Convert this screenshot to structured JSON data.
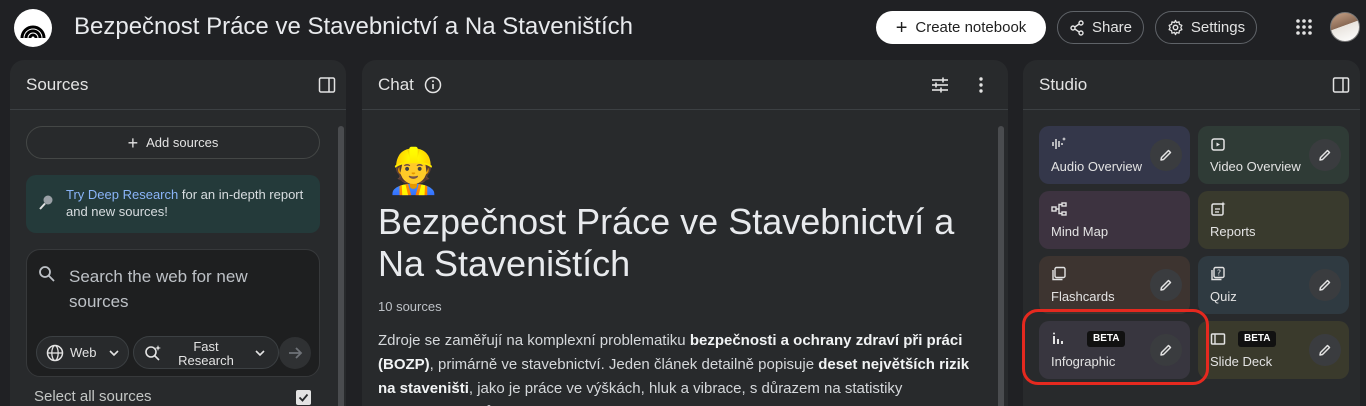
{
  "app": {
    "title": "Bezpečnost Práce ve Stavebnictví a Na Staveništích",
    "logo_icon": "notebooklm-logo-icon"
  },
  "header": {
    "create_label": "Create notebook",
    "share_label": "Share",
    "settings_label": "Settings"
  },
  "sources": {
    "title": "Sources",
    "add_label": "Add sources",
    "deep_link": "Try Deep Research",
    "deep_text": " for an in-depth report and new sources!",
    "search_placeholder": "Search the web for new sources",
    "web_label": "Web",
    "fast_label": "Fast Research",
    "select_all": "Select all sources"
  },
  "chat": {
    "title": "Chat",
    "emoji": "👷",
    "notebook_title": "Bezpečnost Práce ve Stavebnictví a Na Staveništích",
    "source_count": "10 sources",
    "summary": {
      "p1": "Zdroje se zaměřují na komplexní problematiku ",
      "b1": "bezpečnosti a ochrany zdraví při práci (BOZP)",
      "p2": ", primárně ve stavebnictví. Jeden článek detailně popisuje ",
      "b2": "deset největších rizik na staveništi",
      "p3": ", jako je práce ve výškách, hluk a vibrace, s důrazem na statistiky pracovních úrazů."
    }
  },
  "studio": {
    "title": "Studio",
    "cards": {
      "audio": "Audio Overview",
      "video": "Video Overview",
      "mind": "Mind Map",
      "reports": "Reports",
      "flash": "Flashcards",
      "quiz": "Quiz",
      "info": "Infographic",
      "slide": "Slide Deck"
    },
    "beta": "BETA"
  },
  "colors": {
    "background": "#202124",
    "panel": "#282a2c",
    "highlight": "#e5291f"
  }
}
